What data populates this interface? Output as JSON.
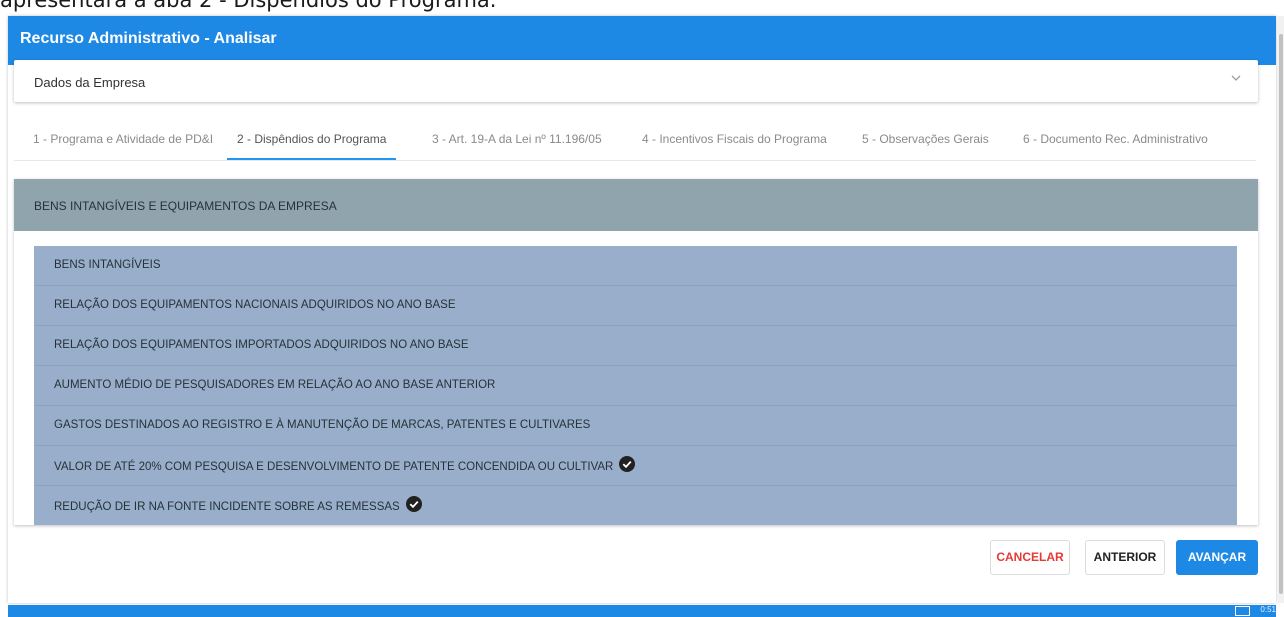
{
  "caption": "apresentará a aba 2 - Dispêndios do Programa.",
  "dialog": {
    "title": "Recurso Administrativo - Analisar",
    "company_panel": {
      "label": "Dados da Empresa"
    },
    "tabs": [
      {
        "label": "1 - Programa e Atividade de PD&I",
        "active": false
      },
      {
        "label": "2 - Dispêndios do Programa",
        "active": true
      },
      {
        "label": "3 - Art. 19-A da Lei nº 11.196/05",
        "active": false
      },
      {
        "label": "4 - Incentivos Fiscais do Programa",
        "active": false
      },
      {
        "label": "5 - Observações Gerais",
        "active": false
      },
      {
        "label": "6 - Documento Rec. Administrativo",
        "active": false
      }
    ],
    "section": {
      "title": "BENS INTANGÍVEIS E EQUIPAMENTOS DA EMPRESA",
      "items": [
        {
          "label": "BENS INTANGÍVEIS",
          "checked": false
        },
        {
          "label": "RELAÇÃO DOS EQUIPAMENTOS NACIONAIS ADQUIRIDOS NO ANO BASE",
          "checked": false
        },
        {
          "label": "RELAÇÃO DOS EQUIPAMENTOS IMPORTADOS ADQUIRIDOS NO ANO BASE",
          "checked": false
        },
        {
          "label": "AUMENTO MÉDIO DE PESQUISADORES EM RELAÇÃO AO ANO BASE ANTERIOR",
          "checked": false
        },
        {
          "label": "GASTOS DESTINADOS AO REGISTRO E À MANUTENÇÃO DE MARCAS, PATENTES E CULTIVARES",
          "checked": false
        },
        {
          "label": "VALOR DE ATÉ 20% COM PESQUISA E DESENVOLVIMENTO DE PATENTE CONCENDIDA OU CULTIVAR",
          "checked": true
        },
        {
          "label": "REDUÇÃO DE IR NA FONTE INCIDENTE SOBRE AS REMESSAS",
          "checked": true
        }
      ]
    },
    "buttons": {
      "cancel": "CANCELAR",
      "previous": "ANTERIOR",
      "next": "AVANÇAR"
    }
  },
  "status_bar": {
    "text": "0:51"
  },
  "colors": {
    "primary": "#1e88e5",
    "section_header": "#90a4ae",
    "item_bg": "#98aeca",
    "cancel_text": "#e53935"
  }
}
